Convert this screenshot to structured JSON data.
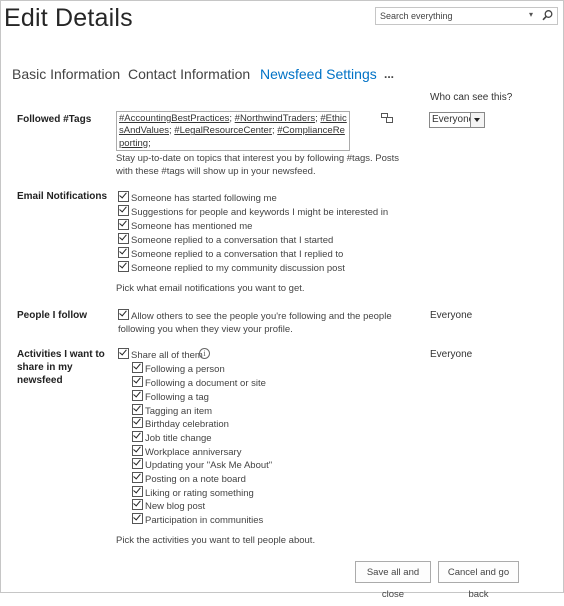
{
  "page": {
    "title": "Edit Details"
  },
  "search": {
    "placeholder": "Search everything"
  },
  "tabs": [
    {
      "label": "Basic Information"
    },
    {
      "label": "Contact Information"
    },
    {
      "label": "Newsfeed Settings"
    },
    {
      "label": "..."
    }
  ],
  "who_header": "Who can see this?",
  "followed_tags": {
    "label": "Followed #Tags",
    "tags": [
      "#AccountingBestPractices",
      "#NorthwindTraders",
      "#EthicsAndValues",
      "#LegalResourceCenter",
      "#ComplianceReporting"
    ],
    "separator": ";",
    "description": "Stay up-to-date on topics that interest you by following #tags. Posts with these #tags will show up in your newsfeed.",
    "visibility": "Everyone"
  },
  "email_notifications": {
    "label": "Email Notifications",
    "items": [
      "Someone has started following me",
      "Suggestions for people and keywords I might be interested in",
      "Someone has mentioned me",
      "Someone replied to a conversation that I started",
      "Someone replied to a conversation that I replied to",
      "Someone replied to my community discussion post"
    ],
    "description": "Pick what email notifications you want to get."
  },
  "people_i_follow": {
    "label": "People I follow",
    "checkbox_text": "Allow others to see the people you're following and the people following you when they view your profile.",
    "visibility": "Everyone"
  },
  "activities": {
    "label": "Activities I want to share in my newsfeed",
    "share_all": "Share all of them",
    "items": [
      "Following a person",
      "Following a document or site",
      "Following a tag",
      "Tagging an item",
      "Birthday celebration",
      "Job title change",
      "Workplace anniversary",
      "Updating your \"Ask Me About\"",
      "Posting on a note board",
      "Liking or rating something",
      "New blog post",
      "Participation in communities"
    ],
    "description": "Pick the activities you want to tell people about.",
    "visibility": "Everyone"
  },
  "buttons": {
    "save": "Save all and close",
    "cancel": "Cancel and go back"
  }
}
